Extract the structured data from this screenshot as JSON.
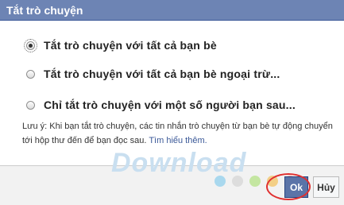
{
  "dialog": {
    "title": "Tắt trò chuyện"
  },
  "options": [
    {
      "label": "Tắt trò chuyện với tất cả bạn bè",
      "checked": true
    },
    {
      "label": "Tắt trò chuyện với tất cả bạn bè ngoại trừ...",
      "checked": false
    },
    {
      "label": "Chỉ tắt trò chuyện với một số người bạn sau...",
      "checked": false
    }
  ],
  "note": {
    "text": "Lưu ý: Khi bạn tắt trò chuyện, các tin nhắn trò chuyện từ bạn bè tự động chuyển tới hộp thư đến để bạn đọc sau.",
    "link": "Tìm hiểu thêm."
  },
  "watermark": "Download",
  "watermark_dot_colors": [
    "#a9d8ee",
    "#dddddd",
    "#c4e6a1",
    "#f3cf86",
    "#f3a9a9"
  ],
  "buttons": {
    "ok": "Ok",
    "cancel": "Hủy"
  },
  "colors": {
    "title_bar": "#6d84b4",
    "ok_button": "#5b74a8",
    "highlight_ring": "#e03030"
  }
}
